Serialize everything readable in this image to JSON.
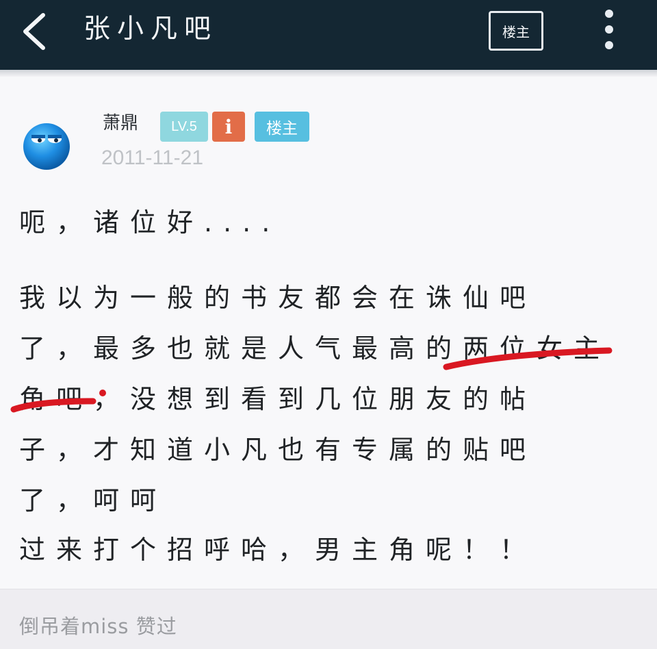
{
  "header": {
    "title": "张小凡吧",
    "owner_button": "楼主",
    "back_icon": "chevron-left-icon",
    "more_icon": "vertical-dots-icon"
  },
  "post": {
    "author": "萧鼎",
    "level_badge": "LV.5",
    "info_badge": "i",
    "owner_badge": "楼主",
    "date": "2011-11-21",
    "lines": [
      "呃，诸位好....",
      "我以为一般的书友都会在诛仙吧",
      "了，最多也就是人气最高的两位女主",
      "角吧，没想到看到几位朋友的帖",
      "子，才知道小凡也有专属的贴吧",
      "了，呵呵",
      "过来打个招呼哈，男主角呢！！"
    ]
  },
  "footer": {
    "likes_text": "倒吊着miss 赞过"
  },
  "colors": {
    "header_bg": "#142733",
    "level_badge": "#8fd7df",
    "info_badge": "#e26d48",
    "owner_badge": "#57bfe0",
    "annotation_red": "#d91822"
  }
}
